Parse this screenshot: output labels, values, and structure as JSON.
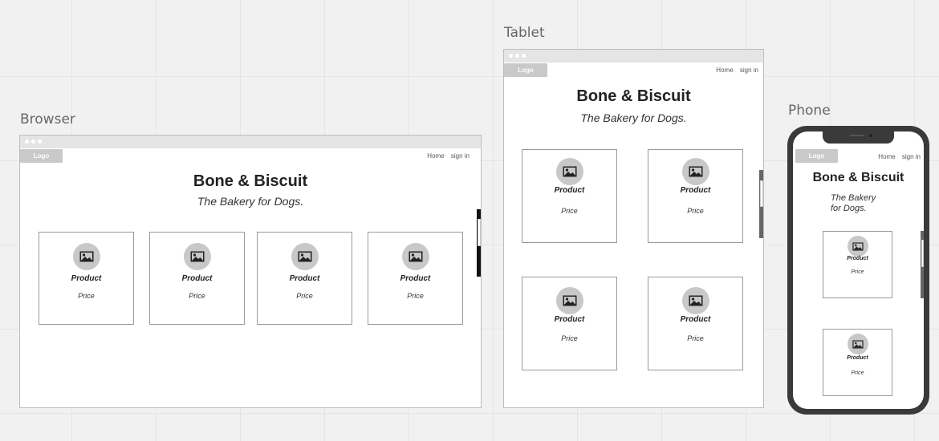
{
  "labels": {
    "browser": "Browser",
    "tablet": "Tablet",
    "phone": "Phone"
  },
  "site": {
    "logo": "Logo",
    "nav_home": "Home",
    "nav_signin": "sign in",
    "title": "Bone & Biscuit",
    "tagline": "The Bakery for Dogs.",
    "tagline_phone_line1": "The Bakery",
    "tagline_phone_line2": "for Dogs."
  },
  "product": {
    "name": "Product",
    "price": "Price"
  },
  "icons": {
    "product_image": "image-icon"
  }
}
